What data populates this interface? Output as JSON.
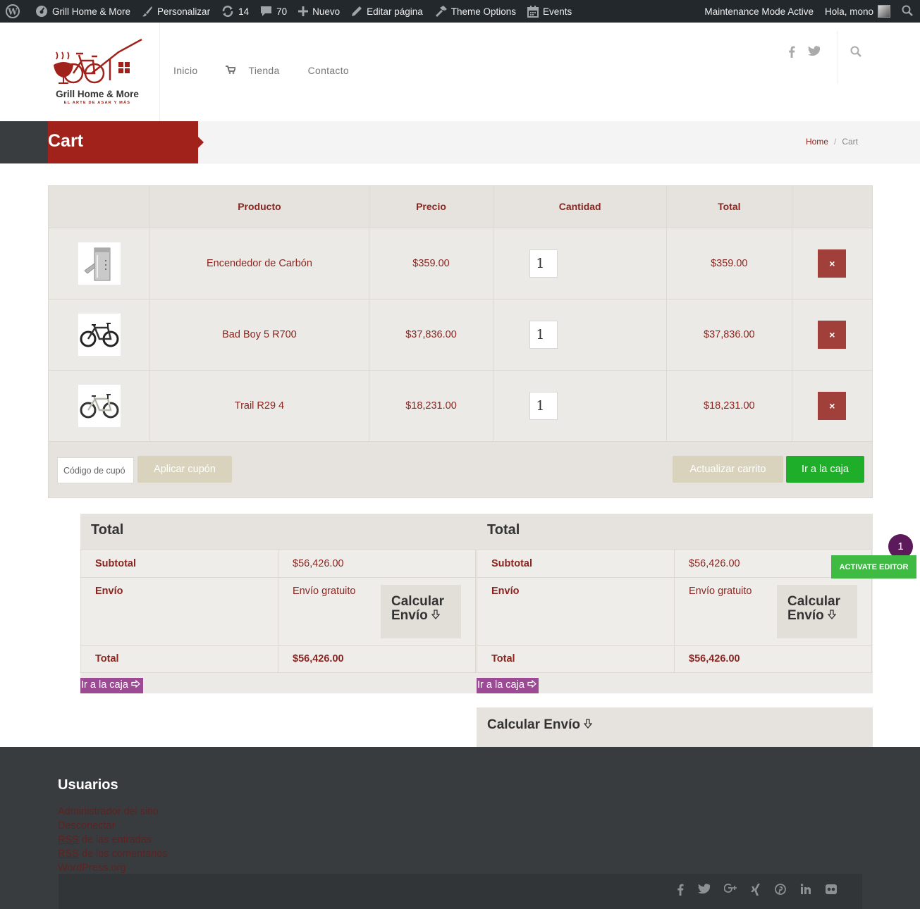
{
  "adminbar": {
    "site": "Grill Home & More",
    "customize": "Personalizar",
    "updates": "14",
    "comments": "70",
    "new": "Nuevo",
    "edit": "Editar página",
    "theme": "Theme Options",
    "events": "Events",
    "maintenance": "Maintenance Mode Active",
    "greeting": "Hola, mono"
  },
  "logo": {
    "name": "Grill Home & More",
    "tagline": "EL ARTE DE ASAR Y MÁS"
  },
  "nav": {
    "home": "Inicio",
    "shop": "Tienda",
    "contact": "Contacto"
  },
  "page": {
    "title": "Cart",
    "crumb_home": "Home",
    "crumb_sep": "/",
    "crumb_current": "Cart"
  },
  "cart": {
    "headers": {
      "product": "Producto",
      "price": "Precio",
      "qty": "Cantidad",
      "total": "Total"
    },
    "items": [
      {
        "name": "Encendedor de Carbón",
        "price": "$359.00",
        "qty": "1",
        "total": "$359.00"
      },
      {
        "name": "Bad Boy 5 R700",
        "price": "$37,836.00",
        "qty": "1",
        "total": "$37,836.00"
      },
      {
        "name": "Trail R29 4",
        "price": "$18,231.00",
        "qty": "1",
        "total": "$18,231.00"
      }
    ],
    "remove": "×",
    "coupon_placeholder": "Código de cupó",
    "apply": "Aplicar cupón",
    "update": "Actualizar carrito",
    "checkout": "Ir a la caja"
  },
  "totals": {
    "heading": "Total",
    "subtotal_label": "Subtotal",
    "subtotal": "$56,426.00",
    "shipping_label": "Envío",
    "shipping": "Envío gratuito",
    "calc_line1": "Calcular",
    "calc_line2": "Envío",
    "total_label": "Total",
    "total": "$56,426.00",
    "checkout": "Ir a la caja"
  },
  "calc_shipping": "Calcular Envío",
  "editor": {
    "badge": "1",
    "label": "ACTIVATE EDITOR"
  },
  "footer": {
    "heading": "Usuarios",
    "admin": "Administrador del sitio",
    "logout": "Desconectar",
    "rss": "RSS",
    "entries": " de las entradas",
    "comments": " de los comentarios",
    "wp": "WordPress.org"
  },
  "colors": {
    "brand_red": "#a0221b",
    "checkout_green": "#1fae2a",
    "footer_bg": "#393c3f"
  }
}
